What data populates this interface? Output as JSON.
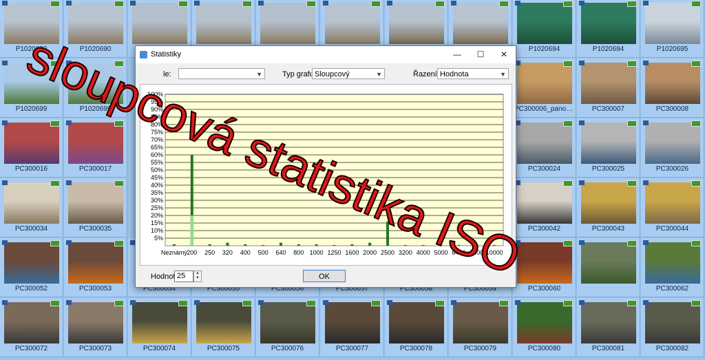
{
  "thumbnails": [
    {
      "caption": "P1020690",
      "col": 0,
      "row": 0,
      "colors": [
        "#b7c3cf",
        "#8a7a63"
      ]
    },
    {
      "caption": "P1020690",
      "col": 1,
      "row": 0,
      "colors": [
        "#b7c3cf",
        "#8a7a63"
      ]
    },
    {
      "caption": "",
      "col": 2,
      "row": 0,
      "colors": [
        "#b3bfcc",
        "#8c7c65"
      ]
    },
    {
      "caption": "",
      "col": 3,
      "row": 0,
      "colors": [
        "#b5c1cd",
        "#8b7b64"
      ]
    },
    {
      "caption": "",
      "col": 4,
      "row": 0,
      "colors": [
        "#b3bfcc",
        "#8c7c65"
      ]
    },
    {
      "caption": "",
      "col": 5,
      "row": 0,
      "colors": [
        "#b7c3cf",
        "#8a7a63"
      ]
    },
    {
      "caption": "",
      "col": 6,
      "row": 0,
      "colors": [
        "#b5c1cd",
        "#7a6a53"
      ]
    },
    {
      "caption": "",
      "col": 7,
      "row": 0,
      "colors": [
        "#b7c3cf",
        "#7d6d56"
      ]
    },
    {
      "caption": "P1020694",
      "col": 8,
      "row": 0,
      "colors": [
        "#2e7a5d",
        "#1d4f3c"
      ]
    },
    {
      "caption": "P1020694",
      "col": 9,
      "row": 0,
      "colors": [
        "#2e7a5d",
        "#1d4f3c"
      ]
    },
    {
      "caption": "P1020695",
      "col": 10,
      "row": 0,
      "colors": [
        "#c9d3dc",
        "#7c8a99"
      ]
    },
    {
      "caption": "P1020699",
      "col": 0,
      "row": 1,
      "colors": [
        "#a9c9e6",
        "#4f7a3a"
      ]
    },
    {
      "caption": "P1020699",
      "col": 1,
      "row": 1,
      "colors": [
        "#a9c9e6",
        "#4f7a3a"
      ]
    },
    {
      "caption": "PC300006_panora...",
      "col": 8,
      "row": 1,
      "colors": [
        "#c79c62",
        "#8d6a45"
      ]
    },
    {
      "caption": "PC300007",
      "col": 9,
      "row": 1,
      "colors": [
        "#b4936f",
        "#6f5a45"
      ]
    },
    {
      "caption": "PC300008",
      "col": 10,
      "row": 1,
      "colors": [
        "#b88d64",
        "#5d4a38"
      ]
    },
    {
      "caption": "PC300016",
      "col": 0,
      "row": 2,
      "colors": [
        "#b34a4a",
        "#5b3a6f"
      ]
    },
    {
      "caption": "PC300017",
      "col": 1,
      "row": 2,
      "colors": [
        "#b34a4a",
        "#7a4a8a"
      ]
    },
    {
      "caption": "PC300024",
      "col": 8,
      "row": 2,
      "colors": [
        "#a8a8a8",
        "#4b5a6a"
      ]
    },
    {
      "caption": "PC300025",
      "col": 9,
      "row": 2,
      "colors": [
        "#b5b5b5",
        "#3d5a7a"
      ]
    },
    {
      "caption": "PC300026",
      "col": 10,
      "row": 2,
      "colors": [
        "#b0b0b0",
        "#4a6a8a"
      ]
    },
    {
      "caption": "PC300034",
      "col": 0,
      "row": 3,
      "colors": [
        "#d9cfbf",
        "#8a7a63"
      ]
    },
    {
      "caption": "PC300035",
      "col": 1,
      "row": 3,
      "colors": [
        "#c9b9a9",
        "#6a5a4a"
      ]
    },
    {
      "caption": "PC300042",
      "col": 8,
      "row": 3,
      "colors": [
        "#d8d0c6",
        "#3a3a3a"
      ]
    },
    {
      "caption": "PC300043",
      "col": 9,
      "row": 3,
      "colors": [
        "#c9a54a",
        "#6a5a3a"
      ]
    },
    {
      "caption": "PC300044",
      "col": 10,
      "row": 3,
      "colors": [
        "#c9a54a",
        "#7a6a4a"
      ]
    },
    {
      "caption": "PC300052",
      "col": 0,
      "row": 4,
      "colors": [
        "#6a4a3a",
        "#3a6a9a"
      ]
    },
    {
      "caption": "PC300053",
      "col": 1,
      "row": 4,
      "colors": [
        "#6a4a3a",
        "#c96a1a"
      ]
    },
    {
      "caption": "PC300054",
      "col": 2,
      "row": 4,
      "colors": [
        "#a9cdf2",
        "#a9cdf2"
      ]
    },
    {
      "caption": "PC300055",
      "col": 3,
      "row": 4,
      "colors": [
        "#a9cdf2",
        "#a9cdf2"
      ]
    },
    {
      "caption": "PC300056",
      "col": 4,
      "row": 4,
      "colors": [
        "#a9cdf2",
        "#a9cdf2"
      ]
    },
    {
      "caption": "PC300057",
      "col": 5,
      "row": 4,
      "colors": [
        "#a9cdf2",
        "#a9cdf2"
      ]
    },
    {
      "caption": "PC300058",
      "col": 6,
      "row": 4,
      "colors": [
        "#a9cdf2",
        "#a9cdf2"
      ]
    },
    {
      "caption": "PC300059",
      "col": 7,
      "row": 4,
      "colors": [
        "#a9cdf2",
        "#a9cdf2"
      ]
    },
    {
      "caption": "PC300060",
      "col": 8,
      "row": 4,
      "colors": [
        "#7a3a2a",
        "#c96a1a"
      ]
    },
    {
      "caption": "",
      "col": 9,
      "row": 4,
      "colors": [
        "#6a7a5a",
        "#3a5a2a"
      ]
    },
    {
      "caption": "PC300062",
      "col": 10,
      "row": 4,
      "colors": [
        "#5a7a3a",
        "#3a6a9a"
      ]
    },
    {
      "caption": "PC300072",
      "col": 0,
      "row": 5,
      "colors": [
        "#7a6a5a",
        "#3a3a3a"
      ]
    },
    {
      "caption": "PC300073",
      "col": 1,
      "row": 5,
      "colors": [
        "#8a7a6a",
        "#3a3a3a"
      ]
    },
    {
      "caption": "PC300074",
      "col": 2,
      "row": 5,
      "colors": [
        "#4a4a3a",
        "#c9a54a"
      ]
    },
    {
      "caption": "PC300075",
      "col": 3,
      "row": 5,
      "colors": [
        "#4a4a3a",
        "#c9a54a"
      ]
    },
    {
      "caption": "PC300076",
      "col": 4,
      "row": 5,
      "colors": [
        "#5a5a4a",
        "#3a3a2a"
      ]
    },
    {
      "caption": "PC300077",
      "col": 5,
      "row": 5,
      "colors": [
        "#5a4a3a",
        "#2a2a2a"
      ]
    },
    {
      "caption": "PC300078",
      "col": 6,
      "row": 5,
      "colors": [
        "#5a4a3a",
        "#2a2a2a"
      ]
    },
    {
      "caption": "PC300079",
      "col": 7,
      "row": 5,
      "colors": [
        "#6a5a4a",
        "#3a3a2a"
      ]
    },
    {
      "caption": "PC300080",
      "col": 8,
      "row": 5,
      "colors": [
        "#3a6a2a",
        "#7a3a2a"
      ]
    },
    {
      "caption": "PC300081",
      "col": 9,
      "row": 5,
      "colors": [
        "#6a6a5a",
        "#3a3a3a"
      ]
    },
    {
      "caption": "PC300082",
      "col": 10,
      "row": 5,
      "colors": [
        "#5a5a4a",
        "#3a3a3a"
      ]
    }
  ],
  "dialog": {
    "title": "Statistiky",
    "minimize_glyph": "—",
    "maximize_glyph": "☐",
    "close_glyph": "✕",
    "field_label": "le:",
    "field_value": "",
    "chart_type_label": "Typ grafu:",
    "chart_type_value": "Sloupcový",
    "sort_label": "Řazení:",
    "sort_value": "Hodnota",
    "value_label": "Hodnot:",
    "value_input": "25",
    "ok_label": "OK"
  },
  "chart_data": {
    "type": "bar",
    "categories": [
      "Neznámý",
      "200",
      "250",
      "320",
      "400",
      "500",
      "640",
      "800",
      "1000",
      "1250",
      "1600",
      "2000",
      "2500",
      "3200",
      "4000",
      "5000",
      "6400",
      "8000",
      "10000"
    ],
    "values": [
      1,
      60,
      1,
      2,
      1,
      0.5,
      2,
      1,
      1,
      0.5,
      1,
      2,
      16,
      0.5,
      0.5,
      0.5,
      0.5,
      1,
      0.5
    ],
    "ylim": [
      0,
      100
    ],
    "yticks": [
      "5%",
      "10%",
      "15%",
      "20%",
      "25%",
      "30%",
      "35%",
      "40%",
      "45%",
      "50%",
      "55%",
      "60%",
      "65%",
      "70%",
      "75%",
      "80%",
      "85%",
      "90%",
      "95%",
      "100%"
    ],
    "highlight_category": "200",
    "colors": {
      "bar": "#1e7a1e",
      "highlight": "#8fe08f",
      "plot_bg": "#fffed6",
      "grid": "#222222"
    }
  },
  "overlay_text": "sloupcová statistika ISO"
}
